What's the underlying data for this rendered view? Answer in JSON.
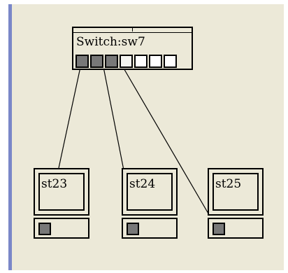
{
  "switch": {
    "title": "Switch:sw7",
    "ports": [
      "used",
      "used",
      "used",
      "half",
      "free",
      "free",
      "free"
    ]
  },
  "stations": [
    {
      "label": "st23"
    },
    {
      "label": "st24"
    },
    {
      "label": "st25"
    }
  ],
  "colors": {
    "canvas_background": "#ece9d8",
    "left_edge_accent": "#7a87c8",
    "port_used": "#787878",
    "port_free": "#ffffff",
    "line": "#000000"
  }
}
